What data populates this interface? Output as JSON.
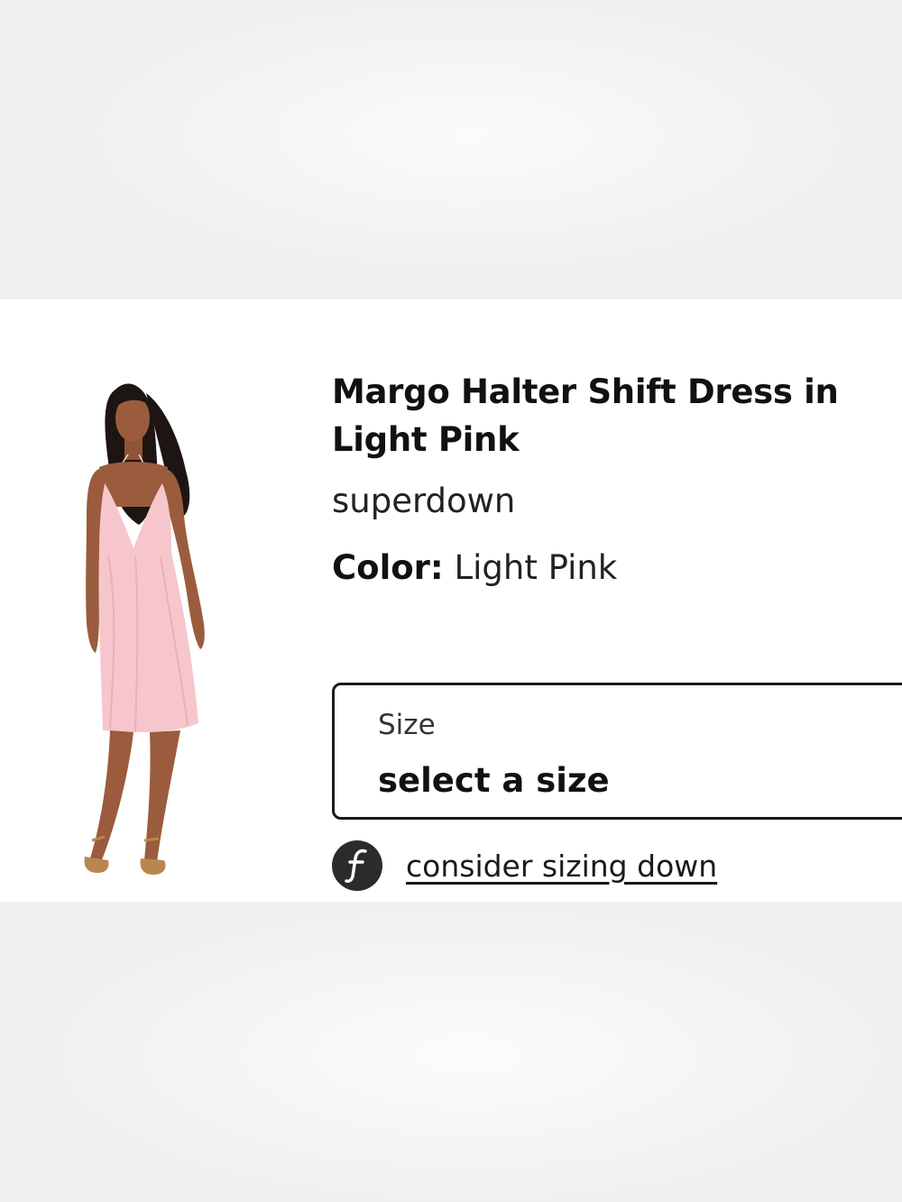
{
  "product": {
    "title": "Margo Halter Shift Dress in Light Pink",
    "brand": "superdown",
    "color_label": "Color:",
    "color_value": "Light Pink"
  },
  "size_selector": {
    "label": "Size",
    "value": "select a size"
  },
  "fit_advice": {
    "icon": "fit-f-icon",
    "link_text": "consider sizing down"
  },
  "colors": {
    "dress": "#f6c6cc",
    "skin": "#9a5c3c",
    "hair": "#1d1512",
    "text": "#111111",
    "border": "#1a1a1a"
  }
}
